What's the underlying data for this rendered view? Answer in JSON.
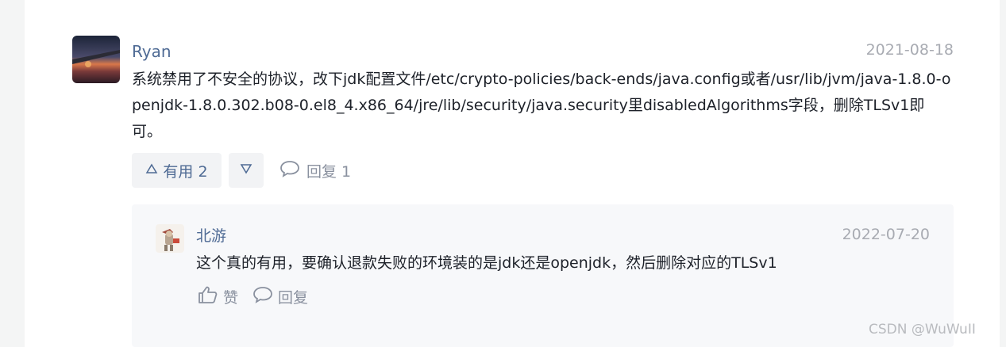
{
  "comment": {
    "username": "Ryan",
    "date": "2021-08-18",
    "avatar_icon": "airplane-sunset-avatar",
    "text": "系统禁用了不安全的协议，改下jdk配置文件/etc/crypto-policies/back-ends/java.config或者/usr/lib/jvm/java-1.8.0-openjdk-1.8.0.302.b08-0.el8_4.x86_64/jre/lib/security/java.security里disabledAlgorithms字段，删除TLSv1即可。",
    "upvote_label": "有用 2",
    "upvote_icon": "triangle-up-icon",
    "downvote_icon": "triangle-down-icon",
    "reply_label": "回复 1",
    "reply_icon": "comment-bubble-icon"
  },
  "reply": {
    "username": "北游",
    "date": "2022-07-20",
    "avatar_icon": "cartoon-avatar",
    "text": "这个真的有用，要确认退款失败的环境装的是jdk还是openjdk，然后删除对应的TLSv1",
    "like_label": "赞",
    "like_icon": "thumbs-up-icon",
    "reply_label": "回复",
    "reply_icon": "comment-bubble-icon"
  },
  "watermark": "CSDN @WuWuII",
  "colors": {
    "username": "#4e6a94",
    "meta": "#a8abb2",
    "text": "#1d2129",
    "button_bg": "#f2f3f5",
    "sub_bg": "#f7f8fa"
  }
}
